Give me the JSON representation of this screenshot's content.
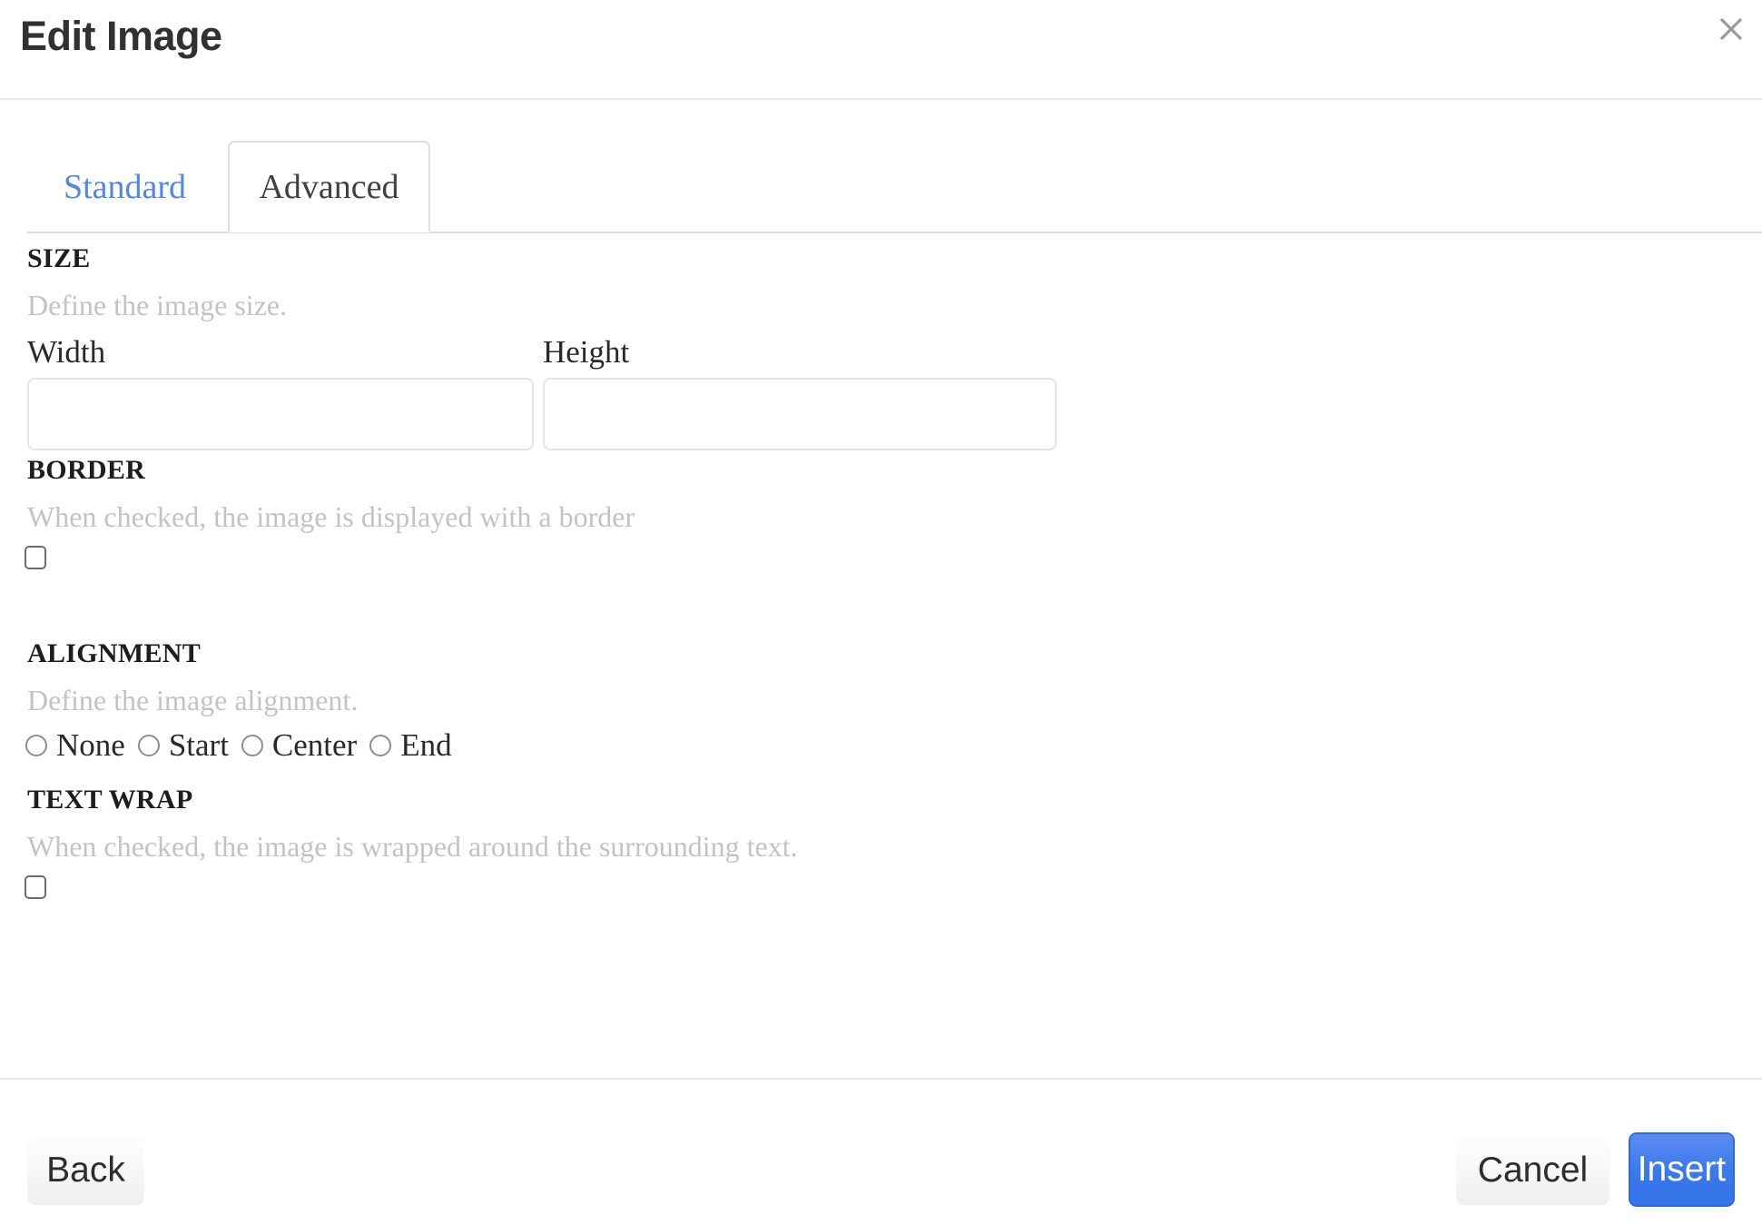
{
  "dialog": {
    "title": "Edit Image",
    "close_icon": "close-icon"
  },
  "tabs": [
    {
      "label": "Standard",
      "active": false
    },
    {
      "label": "Advanced",
      "active": true
    }
  ],
  "sections": {
    "size": {
      "title": "SIZE",
      "description": "Define the image size.",
      "fields": [
        {
          "label": "Width",
          "value": "",
          "placeholder": ""
        },
        {
          "label": "Height",
          "value": "",
          "placeholder": ""
        }
      ]
    },
    "border": {
      "title": "BORDER",
      "description": "When checked, the image is displayed with a border",
      "checked": false
    },
    "alignment": {
      "title": "ALIGNMENT",
      "description": "Define the image alignment.",
      "options": [
        {
          "label": "None",
          "selected": false
        },
        {
          "label": "Start",
          "selected": false
        },
        {
          "label": "Center",
          "selected": false
        },
        {
          "label": "End",
          "selected": false
        }
      ]
    },
    "textwrap": {
      "title": "TEXT WRAP",
      "description": "When checked, the image is wrapped around the surrounding text.",
      "checked": false
    }
  },
  "footer": {
    "back_label": "Back",
    "cancel_label": "Cancel",
    "insert_label": "Insert"
  },
  "colors": {
    "accent_blue": "#3a78ec",
    "tab_link_blue": "#5287e8",
    "muted_text": "#c3c3c3",
    "divider": "#e9e9e9"
  }
}
